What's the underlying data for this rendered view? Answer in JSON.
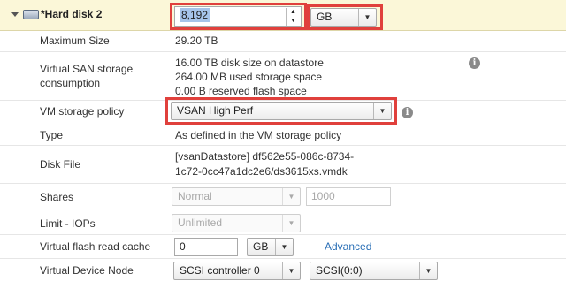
{
  "header": {
    "title": "*Hard disk 2",
    "size_value": "8,192",
    "size_unit": "GB"
  },
  "rows": {
    "max_size": {
      "label": "Maximum Size",
      "value": "29.20 TB"
    },
    "vsan": {
      "label_line1": "Virtual SAN storage",
      "label_line2": "consumption",
      "line1": "16.00 TB disk size on datastore",
      "line2": "264.00 MB used storage space",
      "line3": "0.00 B reserved flash space"
    },
    "policy": {
      "label": "VM storage policy",
      "value": "VSAN High Perf"
    },
    "type": {
      "label": "Type",
      "value": "As defined in the VM storage policy"
    },
    "disk_file": {
      "label": "Disk File",
      "line1": "[vsanDatastore] df562e55-086c-8734-",
      "line2": "1c72-0cc47a1dc2e6/ds3615xs.vmdk"
    },
    "shares": {
      "label": "Shares",
      "select": "Normal",
      "value": "1000"
    },
    "limit": {
      "label": "Limit - IOPs",
      "select": "Unlimited"
    },
    "flash_cache": {
      "label": "Virtual flash read cache",
      "value": "0",
      "unit": "GB",
      "advanced": "Advanced"
    },
    "device_node": {
      "label": "Virtual Device Node",
      "controller": "SCSI controller 0",
      "slot": "SCSI(0:0)"
    }
  },
  "colors": {
    "highlight_border": "#e0403c",
    "header_bg": "#fbf7d8",
    "selection": "#a6c4ea",
    "link": "#2a6fb6"
  },
  "icons": [
    "expand-triangle-icon",
    "hard-disk-icon",
    "spin-up-icon",
    "spin-down-icon",
    "dropdown-arrow-icon",
    "info-icon"
  ]
}
